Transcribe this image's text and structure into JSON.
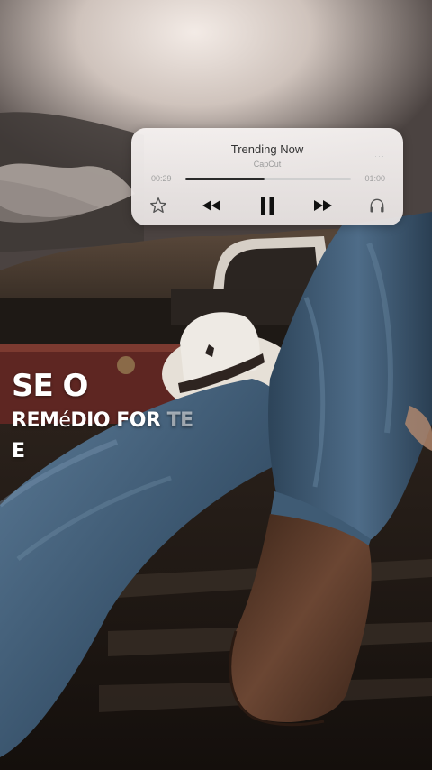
{
  "player": {
    "title": "Trending Now",
    "subtitle": "CapCut",
    "time_elapsed": "00:29",
    "time_total": "01:00",
    "progress": 0.48,
    "icons": [
      "star-icon",
      "rewind-icon",
      "pause-icon",
      "fast-forward-icon",
      "headphones-icon"
    ]
  },
  "lyrics": {
    "line1": "SE O",
    "line2_part1": "REM",
    "line2_accent": "é",
    "line2_part2": "DIO FOR",
    "line2_faded": "TE",
    "line3": "E"
  },
  "colors": {
    "sky_top": "#4a4240",
    "sky_light": "#e9e1dc",
    "denim": "#3d5770",
    "boot": "#5a3a2a",
    "hat": "#e9e4dc",
    "trunk": "#6a2a26"
  }
}
